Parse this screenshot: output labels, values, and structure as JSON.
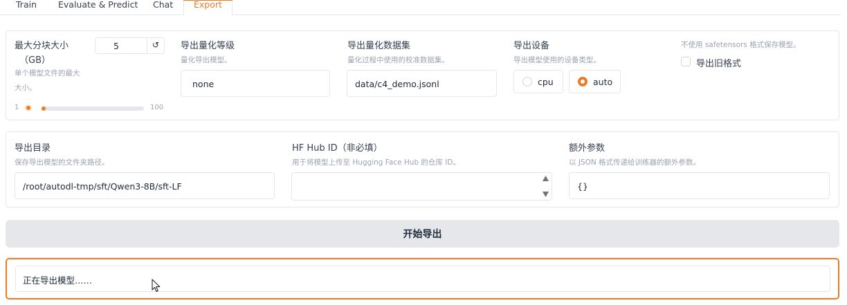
{
  "tabs": [
    {
      "label": "Train"
    },
    {
      "label": "Evaluate & Predict"
    },
    {
      "label": "Chat"
    },
    {
      "label": "Export"
    }
  ],
  "active_tab": "Export",
  "accent_color": "#ea7c28",
  "shard_size": {
    "label_line1": "最大分块大小",
    "label_line2": "（GB）",
    "hint_line1": "单个模型文件的最大",
    "hint_line2": "大小。",
    "value": "5",
    "reset_icon": "↺",
    "min": "1",
    "max": "100",
    "slider_fraction": 0.04
  },
  "quant_bit": {
    "label": "导出量化等级",
    "hint": "量化导出模型。",
    "value": "none"
  },
  "quant_dataset": {
    "label": "导出量化数据集",
    "hint": "量化过程中使用的校准数据集。",
    "value": "data/c4_demo.jsonl"
  },
  "device": {
    "label": "导出设备",
    "hint": "导出模型使用的设备类型。",
    "options": [
      "cpu",
      "auto"
    ],
    "selected": "auto"
  },
  "legacy": {
    "hint": "不使用 safetensors 格式保存模型。",
    "label": "导出旧格式",
    "checked": false
  },
  "export_dir": {
    "label": "导出目录",
    "hint": "保存导出模型的文件夹路径。",
    "value": "/root/autodl-tmp/sft/Qwen3-8B/sft-LF"
  },
  "hub_id": {
    "label": "HF Hub ID（非必填）",
    "hint": "用于将模型上传至 Hugging Face Hub 的仓库 ID。",
    "value": ""
  },
  "extra_args": {
    "label": "额外参数",
    "hint": "以 JSON 格式传递给训练器的额外参数。",
    "value": "{}"
  },
  "export_button": "开始导出",
  "status_text": "正在导出模型……"
}
